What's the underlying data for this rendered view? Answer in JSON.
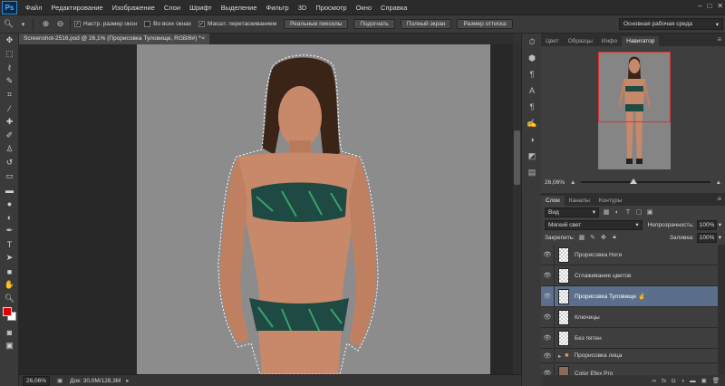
{
  "app": {
    "logo": "Ps",
    "menu": [
      "Файл",
      "Редактирование",
      "Изображение",
      "Слои",
      "Шрифт",
      "Выделение",
      "Фильтр",
      "3D",
      "Просмотр",
      "Окно",
      "Справка"
    ],
    "window_controls": [
      "–",
      "□",
      "✕"
    ]
  },
  "options": {
    "resize_windows": "Настр. размер окон",
    "all_windows": "Во всех окнах",
    "scrubby_zoom": "Масшт. перетаскиванием",
    "btn_actual_pixels": "Реальные пикселы",
    "btn_fit": "Подогнать",
    "btn_fullscreen": "Полный экран",
    "btn_print_size": "Размер оттиска",
    "workspace": "Основная рабочая среда"
  },
  "document": {
    "tab_title": "Screenshot-2516.psd @ 26,1% (Прорисовка Туловище, RGB/8#) *",
    "tab_close": "×",
    "zoom": "26,06%",
    "doc_info": "Док: 30,0M/128,3M"
  },
  "panels": {
    "top_tabs": [
      "Цвет",
      "Образцы",
      "Инфо",
      "Навигатор"
    ],
    "navigator_zoom": "26,06%",
    "layer_tabs": [
      "Слои",
      "Каналы",
      "Контуры"
    ],
    "filter_kind": "Вид",
    "blend_mode": "Мягкий свет",
    "opacity_label": "Непрозрачность:",
    "opacity": "100%",
    "lock_label": "Закрепить:",
    "fill_label": "Заливка:",
    "fill": "100%",
    "layers": [
      {
        "name": "Прорисовка Ноги",
        "kind": "layer",
        "selected": false
      },
      {
        "name": "Сглаживание цветов",
        "kind": "layer",
        "selected": false
      },
      {
        "name": "Прорисовка Туловище",
        "kind": "layer",
        "selected": true
      },
      {
        "name": "Ключицы",
        "kind": "layer",
        "selected": false
      },
      {
        "name": "Без пятен",
        "kind": "layer",
        "selected": false
      },
      {
        "name": "Прорисовка лица",
        "kind": "group",
        "selected": false
      },
      {
        "name": "Color Efex Pro",
        "kind": "photo",
        "selected": false
      }
    ]
  },
  "colors": {
    "foreground": "#e00000",
    "background": "#ffffff",
    "selection_highlight": "#5b6f8c",
    "navigator_frame": "#e03030"
  },
  "figure": {
    "skin": "#c8896a",
    "hair": "#3a2418",
    "swimsuit": "#1f4a44",
    "swimsuit_accent": "#3aa06a"
  }
}
